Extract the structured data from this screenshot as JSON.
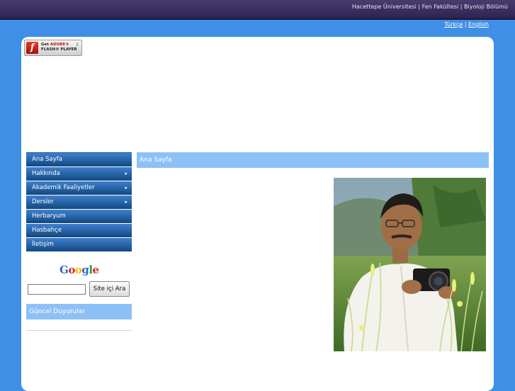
{
  "header": {
    "links": [
      "Hacettepe Üniversitesi",
      "Fen Fakültesi",
      "Biyoloji Bölümü"
    ]
  },
  "language": {
    "turkish": "Türkçe",
    "separator": "|",
    "english": "English"
  },
  "flash_badge": {
    "logo": "f",
    "line1_get": "Get",
    "line1_brand": "ADOBE®",
    "line2": "FLASH® PLAYER"
  },
  "nav": {
    "items": [
      {
        "label": "Ana Sayfa",
        "has_submenu": false
      },
      {
        "label": "Hakkında",
        "has_submenu": true
      },
      {
        "label": "Akademik Faaliyetler",
        "has_submenu": true
      },
      {
        "label": "Dersler",
        "has_submenu": true
      },
      {
        "label": "Herbaryum",
        "has_submenu": false
      },
      {
        "label": "Hasbahçe",
        "has_submenu": false
      },
      {
        "label": "İletişim",
        "has_submenu": false
      }
    ],
    "caret": "▸"
  },
  "search": {
    "logo": "Google",
    "input_value": "",
    "button_label": "Site içi Ara"
  },
  "news": {
    "title": "Güncel Duyurular"
  },
  "main": {
    "title": "Ana Sayfa"
  },
  "colors": {
    "background": "#3f8fe6",
    "topbar": "#3a2d5e",
    "section_header": "#8ec0f8",
    "nav_top": "#3f80cf",
    "nav_bottom": "#11477f"
  }
}
